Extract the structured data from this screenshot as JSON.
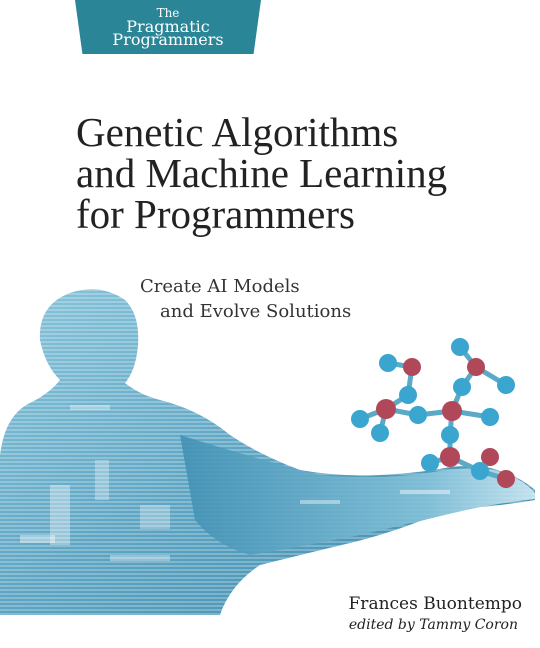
{
  "publisher": {
    "line1": "The",
    "line2": "Pragmatic",
    "line3": "Programmers"
  },
  "title": {
    "line1": "Genetic Algorithms",
    "line2": "and Machine Learning",
    "line3": "for Programmers"
  },
  "subtitle": {
    "line1": "Create AI Models",
    "line2": "and Evolve Solutions"
  },
  "author": "Frances Buontempo",
  "editor": "edited by Tammy Coron",
  "colors": {
    "publisher_teal": "#2a8596",
    "atom_blue": "#3aa6cf",
    "atom_red": "#b0485a",
    "figure_blue": "#5ea9c7"
  }
}
